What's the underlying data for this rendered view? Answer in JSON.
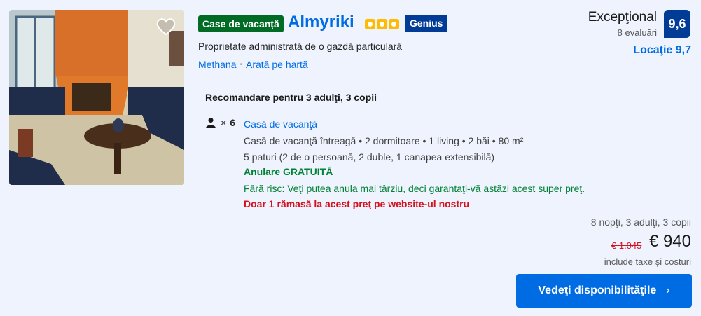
{
  "listing": {
    "type_badge": "Case de vacanță",
    "title": "Almyriki",
    "stars": 3,
    "genius": "Genius",
    "host": "Proprietate administrată de o gazdă particulară",
    "location_link": "Methana",
    "map_link": "Arată pe hartă",
    "favorite_icon": "heart-icon"
  },
  "review": {
    "word": "Excepţional",
    "count": "8 evaluări",
    "score": "9,6",
    "location": "Locaţie 9,7"
  },
  "recommendation": {
    "title": "Recomandare pentru 3 adulţi, 3 copii",
    "guests_multiplier": "×",
    "guests_count": "6",
    "unit_type": "Casă de vacanţă",
    "details": "Casă de vacanţă întreagă • 2 dormitoare • 1 living • 2 băi • 80 m²",
    "beds": "5 paturi (2 de o persoană, 2 duble, 1 canapea extensibilă)",
    "cancellation": "Anulare GRATUITĂ",
    "no_risk": "Fără risc: Veţi putea anula mai târziu, deci garantaţi-vă astăzi acest super preţ.",
    "scarcity": "Doar 1 rămasă la acest preţ pe website-ul nostru"
  },
  "price": {
    "stay": "8 nopţi, 3 adulţi, 3 copii",
    "old": "€ 1.045",
    "current": "€ 940",
    "taxes": "include taxe şi costuri"
  },
  "cta": {
    "label": "Vedeţi disponibilităţile",
    "chevron": "›"
  },
  "colors": {
    "background": "#eef3fd",
    "brand_blue": "#006ce4",
    "dark_blue": "#003b95",
    "green": "#008234",
    "red": "#d4111e",
    "star_yellow": "#febb02"
  }
}
